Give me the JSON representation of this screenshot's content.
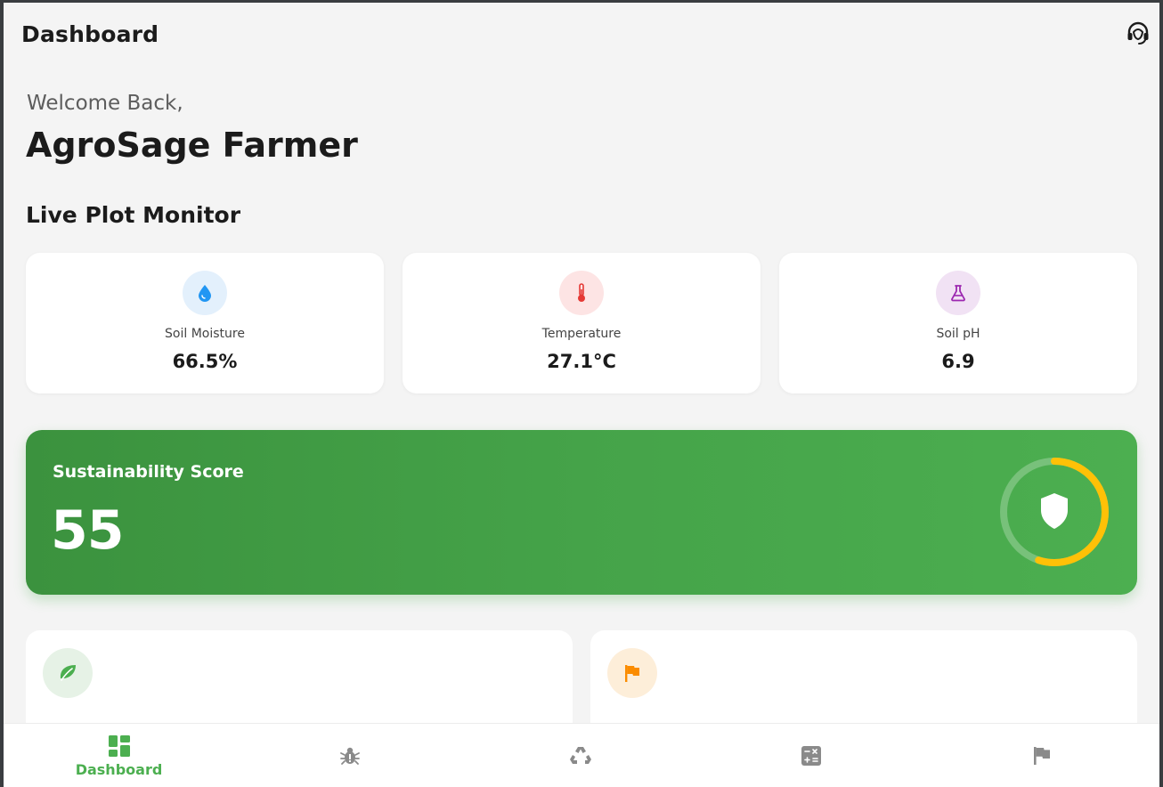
{
  "header": {
    "title": "Dashboard",
    "support_icon": "headset-icon"
  },
  "welcome": {
    "greeting": "Welcome Back,",
    "name": "AgroSage Farmer"
  },
  "monitor": {
    "title": "Live Plot Monitor",
    "metrics": [
      {
        "icon": "water-drop-icon",
        "label": "Soil Moisture",
        "value": "66.5%",
        "icon_color": "#2196f3",
        "icon_bg": "#e3f0fc"
      },
      {
        "icon": "thermometer-icon",
        "label": "Temperature",
        "value": "27.1°C",
        "icon_color": "#e53935",
        "icon_bg": "#fde4e4"
      },
      {
        "icon": "flask-icon",
        "label": "Soil pH",
        "value": "6.9",
        "icon_color": "#9c27b0",
        "icon_bg": "#f1e2f4"
      }
    ]
  },
  "sustainability": {
    "label": "Sustainability Score",
    "value": "55",
    "progress": 0.55,
    "ring_color": "#ffc107",
    "icon": "shield-icon"
  },
  "cards": [
    {
      "icon": "leaf-icon",
      "icon_color": "#4caf50",
      "icon_bg": "#e6f2e6"
    },
    {
      "icon": "flag-icon",
      "icon_color": "#fb8c00",
      "icon_bg": "#fdeed9"
    }
  ],
  "nav": {
    "active_color": "#4caf50",
    "inactive_color": "#8a8a8a",
    "items": [
      {
        "icon": "dashboard-icon",
        "label": "Dashboard",
        "active": true
      },
      {
        "icon": "bug-icon",
        "label": "",
        "active": false
      },
      {
        "icon": "recycle-icon",
        "label": "",
        "active": false
      },
      {
        "icon": "calculator-icon",
        "label": "",
        "active": false
      },
      {
        "icon": "flag-icon",
        "label": "",
        "active": false
      }
    ]
  }
}
